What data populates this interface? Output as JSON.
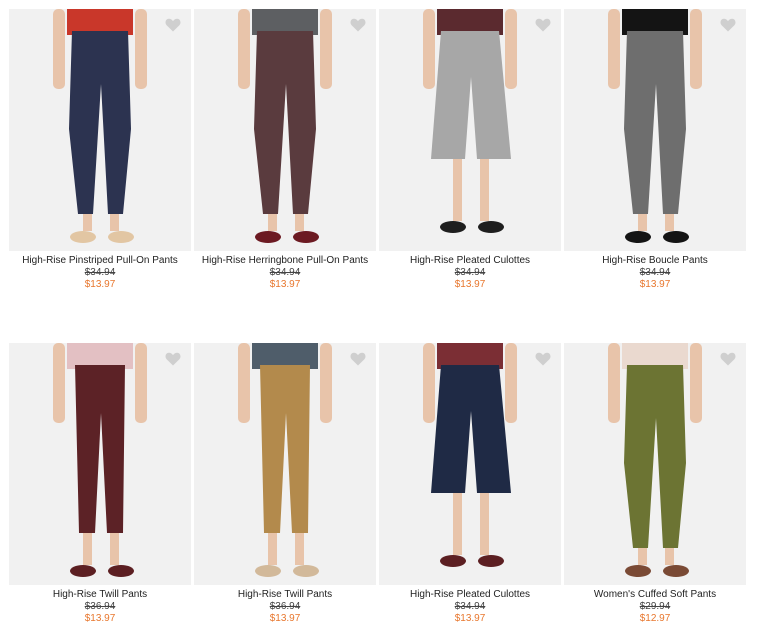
{
  "products": [
    {
      "name": "High-Rise Pinstriped Pull-On Pants",
      "old_price": "$34.94",
      "price": "$13.97",
      "pant_color": "#2c3350",
      "top_color": "#c9372a",
      "shoe_color": "#e2c6a3",
      "style": "tapered"
    },
    {
      "name": "High-Rise Herringbone Pull-On Pants",
      "old_price": "$34.94",
      "price": "$13.97",
      "pant_color": "#5a3b3e",
      "top_color": "#5d5f62",
      "shoe_color": "#6c1a22",
      "style": "tapered"
    },
    {
      "name": "High-Rise Pleated Culottes",
      "old_price": "$34.94",
      "price": "$13.97",
      "pant_color": "#a7a7a7",
      "top_color": "#5b2a2f",
      "shoe_color": "#1e1e1e",
      "style": "culotte"
    },
    {
      "name": "High-Rise Boucle Pants",
      "old_price": "$34.94",
      "price": "$13.97",
      "pant_color": "#6e6e6e",
      "top_color": "#141414",
      "shoe_color": "#141414",
      "style": "tapered"
    },
    {
      "name": "High-Rise Twill Pants",
      "old_price": "$36.94",
      "price": "$13.97",
      "pant_color": "#5c2226",
      "top_color": "#e3c0c3",
      "shoe_color": "#5c1f22",
      "style": "slim"
    },
    {
      "name": "High-Rise Twill Pants",
      "old_price": "$36.94",
      "price": "$13.97",
      "pant_color": "#b38a4c",
      "top_color": "#4f5d6a",
      "shoe_color": "#d2b99a",
      "style": "slim"
    },
    {
      "name": "High-Rise Pleated Culottes",
      "old_price": "$34.94",
      "price": "$13.97",
      "pant_color": "#1f2a45",
      "top_color": "#7b2e34",
      "shoe_color": "#5c1f22",
      "style": "culotte"
    },
    {
      "name": "Women's Cuffed Soft Pants",
      "old_price": "$29.94",
      "price": "$12.97",
      "pant_color": "#6c7433",
      "top_color": "#ead9cf",
      "shoe_color": "#7a4a35",
      "style": "tapered"
    }
  ]
}
